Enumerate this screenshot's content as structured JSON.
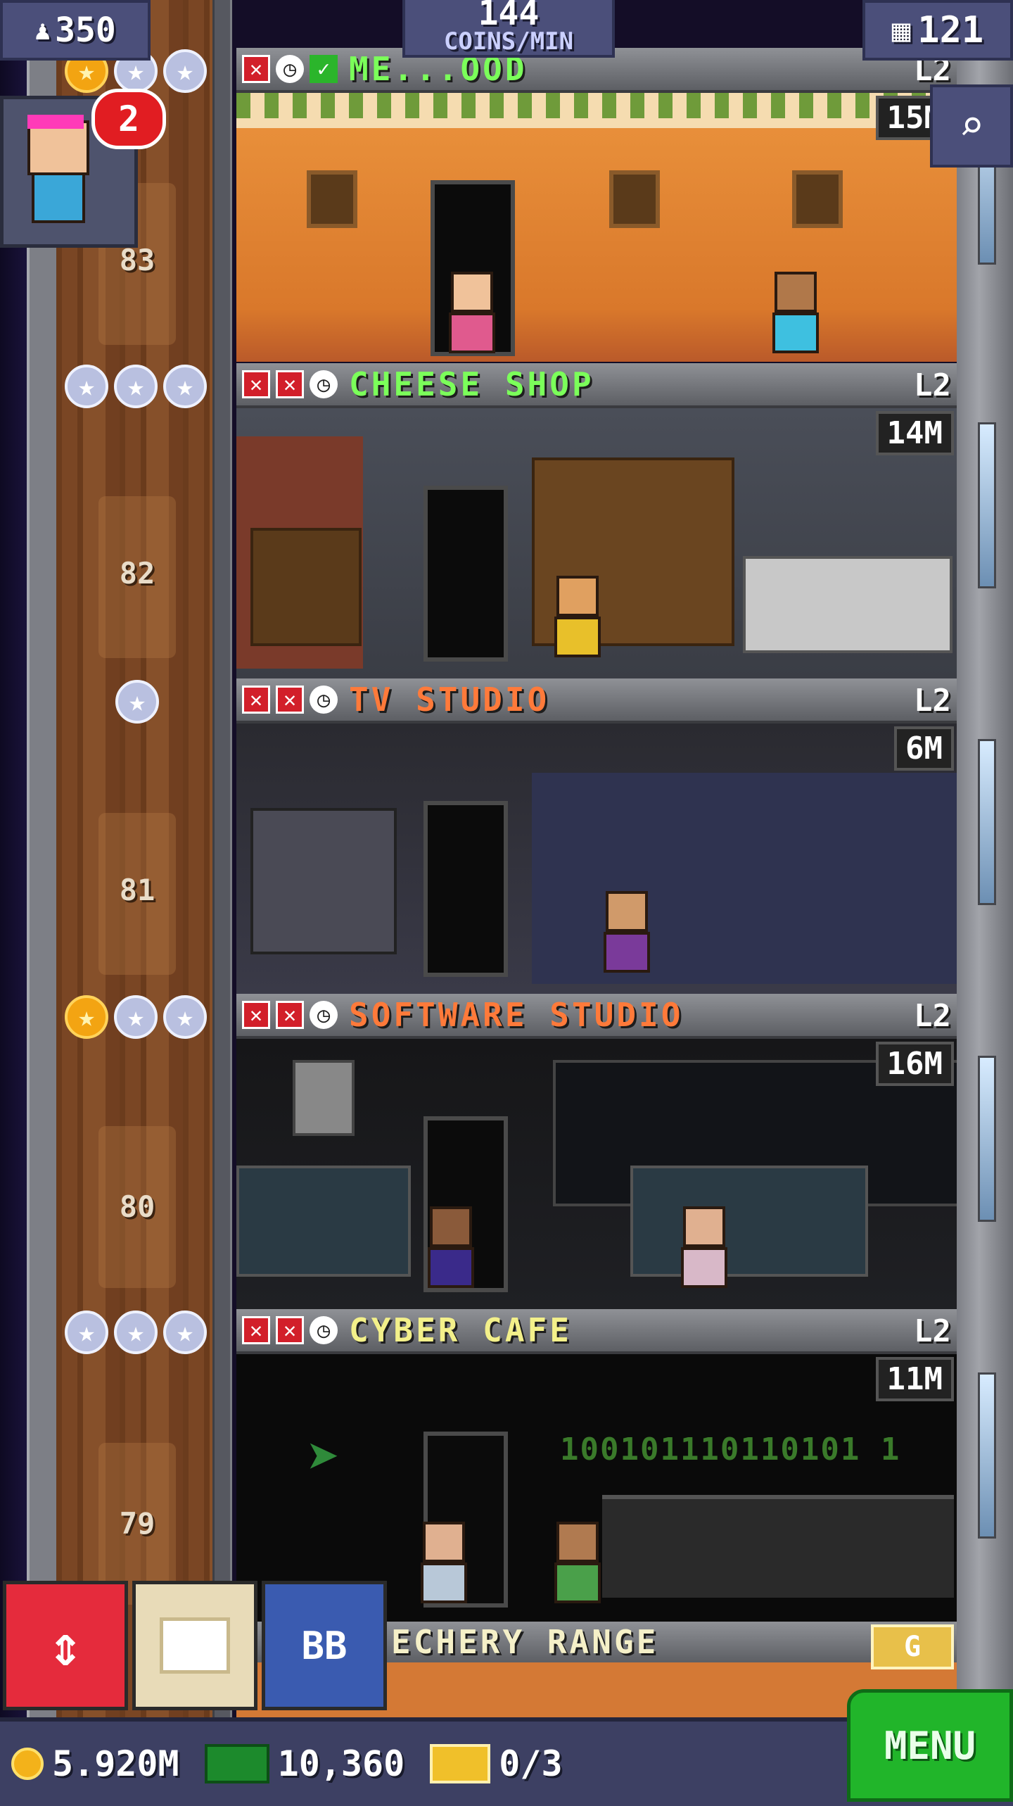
{
  "hud": {
    "population": "350",
    "coin_rate_value": "144",
    "coin_rate_label": "COINS/MIN",
    "floor_count": "121",
    "notification_count": "2"
  },
  "floors": [
    {
      "name": "ME...OOD",
      "level": "L2",
      "cost": "15M",
      "number": "83",
      "name_color": "#7bff5a"
    },
    {
      "name": "CHEESE SHOP",
      "level": "L2",
      "cost": "14M",
      "number": "82",
      "name_color": "#7bff5a"
    },
    {
      "name": "TV STUDIO",
      "level": "L2",
      "cost": "6M",
      "number": "81",
      "name_color": "#ff7a3a"
    },
    {
      "name": "SOFTWARE STUDIO",
      "level": "L2",
      "cost": "16M",
      "number": "80",
      "name_color": "#ff7a3a"
    },
    {
      "name": "CYBER CAFE",
      "level": "L2",
      "cost": "11M",
      "number": "79",
      "name_color": "#f3f08a"
    }
  ],
  "partial_floor": {
    "name": "ECHERY RANGE",
    "badge": "G"
  },
  "cyber_cafe_binary": "100101110110101 1",
  "buttons": {
    "bb": "BB",
    "menu": "MENU"
  },
  "currency": {
    "coins": "5.920M",
    "bux": "10,360",
    "tickets": "0/3"
  },
  "icons": [
    "person-icon",
    "floors-grid-icon",
    "search-icon",
    "star-icon",
    "x-icon",
    "clock-icon",
    "check-icon",
    "elevator-arrows-icon",
    "box-icon",
    "coin-icon",
    "bux-icon",
    "ticket-icon"
  ]
}
